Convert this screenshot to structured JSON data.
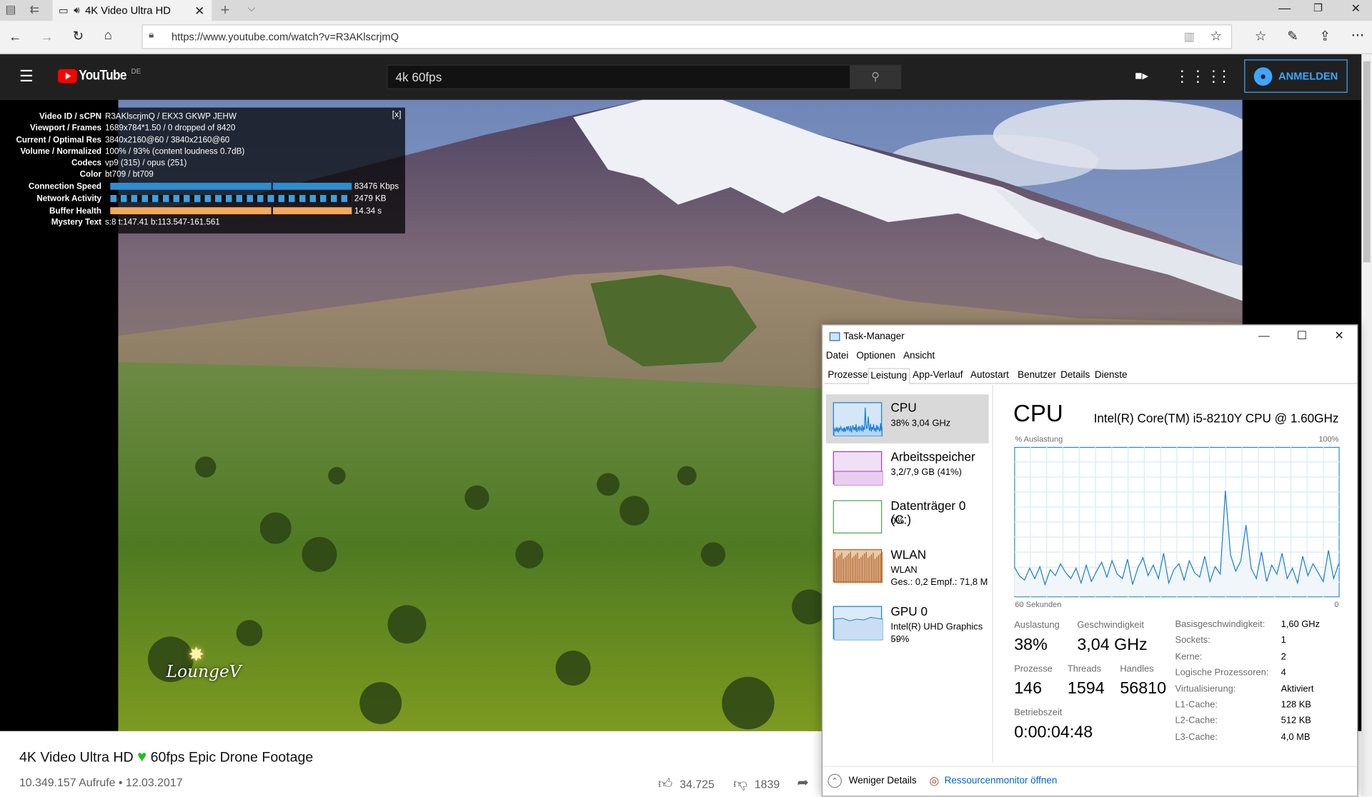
{
  "browser": {
    "tab_title": "4K Video Ultra HD",
    "url": "https://www.youtube.com/watch?v=R3AKlscrjmQ"
  },
  "youtube": {
    "logo_text": "YouTube",
    "region": "DE",
    "search_value": "4k 60fps",
    "signin_label": "ANMELDEN"
  },
  "stats": {
    "rows": [
      {
        "label": "Video ID / sCPN",
        "value": "R3AKlscrjmQ / EKX3 GKWP JEHW"
      },
      {
        "label": "Viewport / Frames",
        "value": "1689x784*1.50 / 0 dropped of 8420"
      },
      {
        "label": "Current / Optimal Res",
        "value": "3840x2160@60 / 3840x2160@60"
      },
      {
        "label": "Volume / Normalized",
        "value": "100% / 93% (content loudness 0.7dB)"
      },
      {
        "label": "Codecs",
        "value": "vp9 (315) / opus (251)"
      },
      {
        "label": "Color",
        "value": "bt709 / bt709"
      },
      {
        "label": "Connection Speed",
        "value": "83476 Kbps"
      },
      {
        "label": "Network Activity",
        "value": "2479 KB"
      },
      {
        "label": "Buffer Health",
        "value": "14.34 s"
      },
      {
        "label": "Mystery Text",
        "value": "s:8 t:147.41 b:113.547-161.561"
      }
    ],
    "close": "[x]"
  },
  "watermark": "LoungeV",
  "video": {
    "title_part1": "4K Video Ultra HD",
    "title_part2": "60fps Epic Drone Footage",
    "views_date": "10.349.157 Aufrufe • 12.03.2017",
    "likes": "34.725",
    "dislikes": "1839"
  },
  "taskmanager": {
    "title": "Task-Manager",
    "menu": [
      "Datei",
      "Optionen",
      "Ansicht"
    ],
    "tabs": [
      "Prozesse",
      "Leistung",
      "App-Verlauf",
      "Autostart",
      "Benutzer",
      "Details",
      "Dienste"
    ],
    "sidebar": [
      {
        "name": "CPU",
        "sub": "38% 3,04 GHz",
        "sub2": ""
      },
      {
        "name": "Arbeitsspeicher",
        "sub": "3,2/7,9 GB (41%)",
        "sub2": ""
      },
      {
        "name": "Datenträger 0 (C:)",
        "sub": "0%",
        "sub2": ""
      },
      {
        "name": "WLAN",
        "sub": "WLAN",
        "sub2": "Ges.: 0,2  Empf.: 71,8 M"
      },
      {
        "name": "GPU 0",
        "sub": "Intel(R) UHD Graphics ...",
        "sub2": "59%"
      }
    ],
    "heading": "CPU",
    "cpu_model": "Intel(R) Core(TM) i5-8210Y CPU @ 1.60GHz",
    "graph_label_tl": "% Auslastung",
    "graph_label_tr": "100%",
    "graph_label_bl": "60 Sekunden",
    "graph_label_br": "0",
    "stats": {
      "auslastung_label": "Auslastung",
      "auslastung": "38%",
      "geschw_label": "Geschwindigkeit",
      "geschw": "3,04 GHz",
      "prozesse_label": "Prozesse",
      "prozesse": "146",
      "threads_label": "Threads",
      "threads": "1594",
      "handles_label": "Handles",
      "handles": "56810",
      "betrieb_label": "Betriebszeit",
      "betrieb": "0:00:04:48"
    },
    "details": [
      {
        "k": "Basisgeschwindigkeit:",
        "v": "1,60 GHz"
      },
      {
        "k": "Sockets:",
        "v": "1"
      },
      {
        "k": "Kerne:",
        "v": "2"
      },
      {
        "k": "Logische Prozessoren:",
        "v": "4"
      },
      {
        "k": "Virtualisierung:",
        "v": "Aktiviert"
      },
      {
        "k": "L1-Cache:",
        "v": "128 KB"
      },
      {
        "k": "L2-Cache:",
        "v": "512 KB"
      },
      {
        "k": "L3-Cache:",
        "v": "4,0 MB"
      }
    ],
    "footer_less": "Weniger Details",
    "footer_resmon": "Ressourcenmonitor öffnen",
    "cpu_history": [
      20,
      14,
      11,
      19,
      12,
      20,
      8,
      18,
      14,
      22,
      16,
      12,
      19,
      9,
      21,
      10,
      17,
      23,
      13,
      24,
      15,
      12,
      25,
      8,
      19,
      26,
      14,
      21,
      12,
      29,
      9,
      18,
      22,
      11,
      24,
      16,
      13,
      27,
      10,
      20,
      15,
      71,
      28,
      17,
      24,
      48,
      19,
      12,
      30,
      10,
      21,
      15,
      29,
      12,
      19,
      9,
      27,
      14,
      22,
      16,
      10,
      31,
      12,
      22
    ]
  }
}
